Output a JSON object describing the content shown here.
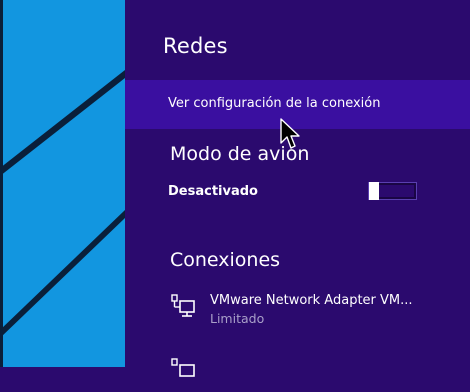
{
  "panel": {
    "title": "Redes",
    "settings_link": "Ver configuración de la conexión",
    "airplane_mode": {
      "title": "Modo de avión",
      "state_label": "Desactivado",
      "enabled": false
    },
    "connections": {
      "title": "Conexiones",
      "items": [
        {
          "name": "VMware Network Adapter VM...",
          "status": "Limitado",
          "icon": "wired-network-icon"
        }
      ]
    }
  },
  "colors": {
    "panel_bg": "#2b0a6e",
    "highlight_bg": "#3a0fa0",
    "desktop_bg": "#1296e0",
    "muted_text": "#a99fc9"
  }
}
